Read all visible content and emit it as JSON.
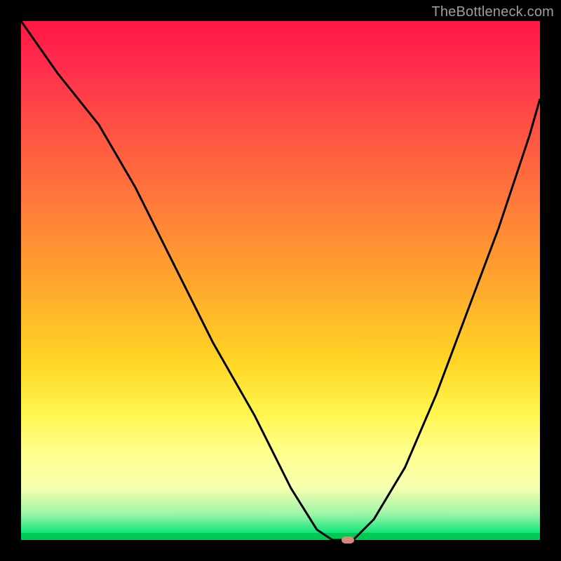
{
  "watermark": "TheBottleneck.com",
  "colors": {
    "frame": "#000000",
    "grad_top": "#ff1744",
    "grad_mid1": "#ff7a3a",
    "grad_mid2": "#ffd324",
    "grad_low": "#ffff8c",
    "grad_green": "#00e676",
    "curve": "#000000",
    "marker": "#d98880"
  },
  "chart_data": {
    "type": "line",
    "title": "",
    "xlabel": "",
    "ylabel": "",
    "xlim": [
      0,
      100
    ],
    "ylim": [
      0,
      100
    ],
    "series": [
      {
        "name": "bottleneck-curve",
        "x": [
          0,
          7,
          15,
          22,
          30,
          37,
          45,
          52,
          57,
          60,
          62,
          64,
          68,
          74,
          80,
          86,
          92,
          98,
          100
        ],
        "y": [
          100,
          90,
          80,
          68,
          52,
          38,
          24,
          10,
          2,
          0,
          0,
          0,
          4,
          14,
          28,
          44,
          60,
          78,
          85
        ]
      }
    ],
    "marker": {
      "x": 63,
      "y": 0
    },
    "annotations": []
  }
}
